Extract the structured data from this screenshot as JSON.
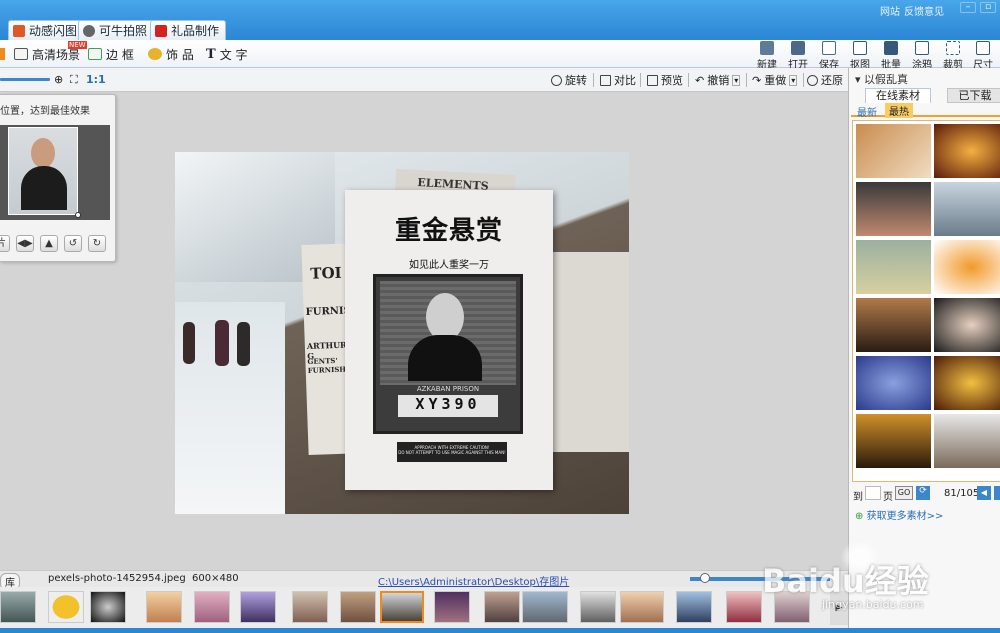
{
  "titlebar": {
    "tabs": [
      {
        "label": "动感闪图",
        "color": "#e0572a"
      },
      {
        "label": "可牛拍照",
        "color": "#555555"
      },
      {
        "label": "礼品制作",
        "color": "#d42222"
      }
    ],
    "links": [
      "网站",
      "反馈意见"
    ]
  },
  "toolbar": {
    "left": [
      {
        "label": "高清场景",
        "badge": "NEW"
      },
      {
        "label": "边 框"
      },
      {
        "label": "饰 品"
      },
      {
        "label": "文 字"
      }
    ],
    "right": [
      {
        "label": "新建",
        "icon": "new-icon"
      },
      {
        "label": "打开",
        "icon": "open-folder-icon"
      },
      {
        "label": "保存",
        "icon": "save-icon"
      },
      {
        "label": "抠图",
        "icon": "cutout-icon"
      },
      {
        "label": "批量",
        "icon": "batch-icon"
      },
      {
        "label": "涂鸦",
        "icon": "paint-icon"
      },
      {
        "label": "裁剪",
        "icon": "crop-icon"
      },
      {
        "label": "尺寸",
        "icon": "resize-icon"
      }
    ]
  },
  "editbar": {
    "zoom_ratio": "1:1",
    "actions": [
      "旋转",
      "对比",
      "预览",
      "撤销",
      "重做",
      "还原"
    ]
  },
  "leftpanel": {
    "hint": "位置，达到最佳效果",
    "btn_label": "片"
  },
  "poster": {
    "title": "重金悬赏",
    "subtitle": "如见此人重奖一万",
    "prison": "AZKABAN PRISON",
    "number": "XY390",
    "caution1": "APPROACH WITH EXTREME CAUTION!",
    "caution2": "DO NOT ATTEMPT TO USE MAGIC AGAINST THIS MAN!",
    "news1": "TOI",
    "news2": "FURNISHING",
    "news3": "ARTHUR B. G",
    "news4": "GENTS' FURNISHI",
    "news5": "ELEMENTS"
  },
  "rightpanel": {
    "header": "以假乱真",
    "tabs": [
      "在线素材",
      "已下载"
    ],
    "subtabs": [
      "最新",
      "最热"
    ],
    "page_label_pre": "到",
    "page_label_post": "页",
    "go": "GO",
    "page_count": "81/105",
    "more": "获取更多素材>>"
  },
  "statusbar": {
    "lib": "库",
    "filename": "pexels-photo-1452954.jpeg",
    "dimensions": "600×480",
    "path": "C:\\Users\\Administrator\\Desktop\\存图片"
  },
  "watermark": {
    "text": "Baidu经验",
    "url": "jingyan.baidu.com"
  }
}
